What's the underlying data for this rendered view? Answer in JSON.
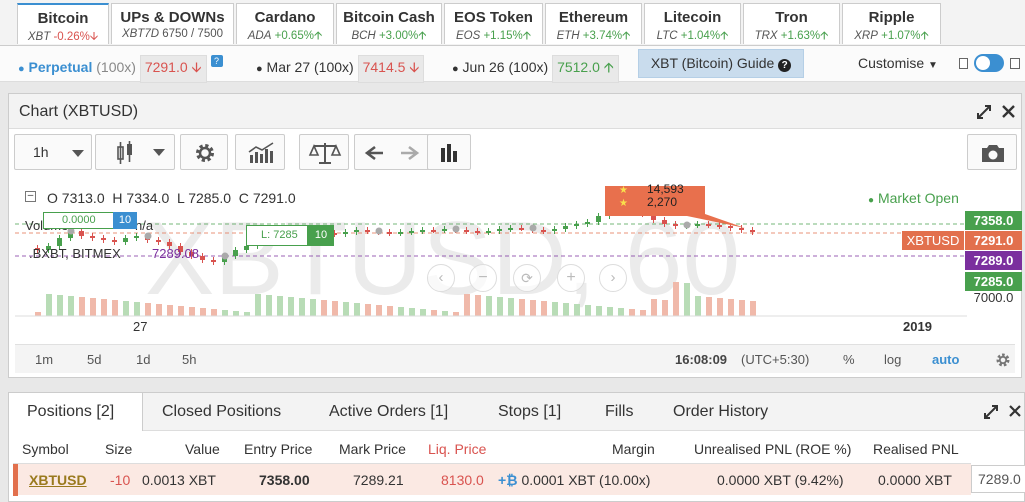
{
  "instruments": [
    {
      "name": "Bitcoin",
      "code": "XBT",
      "change": "-0.26%",
      "dir": "down"
    },
    {
      "name": "UPs & DOWNs",
      "code": "XBT7D",
      "change": "6750 / 7500",
      "dir": "none"
    },
    {
      "name": "Cardano",
      "code": "ADA",
      "change": "+0.65%",
      "dir": "up"
    },
    {
      "name": "Bitcoin Cash",
      "code": "BCH",
      "change": "+3.00%",
      "dir": "up"
    },
    {
      "name": "EOS Token",
      "code": "EOS",
      "change": "+1.15%",
      "dir": "up"
    },
    {
      "name": "Ethereum",
      "code": "ETH",
      "change": "+3.74%",
      "dir": "up"
    },
    {
      "name": "Litecoin",
      "code": "LTC",
      "change": "+1.04%",
      "dir": "up"
    },
    {
      "name": "Tron",
      "code": "TRX",
      "change": "+1.63%",
      "dir": "up"
    },
    {
      "name": "Ripple",
      "code": "XRP",
      "change": "+1.07%",
      "dir": "up"
    }
  ],
  "contracts": {
    "perpetual": {
      "label": "Perpetual",
      "lev": "(100x)",
      "price": "7291.0",
      "dir": "down"
    },
    "mar": {
      "label": "Mar 27",
      "lev": "(100x)",
      "price": "7414.5",
      "dir": "down"
    },
    "jun": {
      "label": "Jun 26",
      "lev": "(100x)",
      "price": "7512.0",
      "dir": "up"
    },
    "guide": "XBT (Bitcoin) Guide",
    "customise": "Customise"
  },
  "chart": {
    "title": "Chart (XBTUSD)",
    "interval": "1h",
    "watermark": "XBTUSD, 60",
    "ohlc": {
      "o_label": "O",
      "o": "7313.0",
      "h_label": "H",
      "h": "7334.0",
      "l_label": "L",
      "l": "7285.0",
      "c_label": "C",
      "c": "7291.0"
    },
    "volume_label": "Volume",
    "volume_value": "n/a",
    "index_label": ".BXBT, BITMEX",
    "index_value": "7289.08",
    "market_status": "Market Open",
    "order_tag": "0.0000",
    "order_qty": "10",
    "liq_tag": "L: 7285",
    "liq_qty": "10",
    "callout_1": "14,593",
    "callout_2": "2,270",
    "price_labels": [
      {
        "text": "7358.0",
        "color": "#48a04d"
      },
      {
        "text": "XBTUSD",
        "color": "#e2704d"
      },
      {
        "text": "7291.0",
        "color": "#e2704d"
      },
      {
        "text": "7289.0",
        "color": "#7b2f9e"
      },
      {
        "text": "7285.0",
        "color": "#48a04d"
      },
      {
        "text": "7000.0",
        "color": "#ffffff"
      }
    ],
    "x_tick_1": "27",
    "x_tick_2": "2019",
    "ranges": [
      "1m",
      "5d",
      "1d",
      "5h"
    ],
    "clock": "16:08:09",
    "tz": "(UTC+5:30)",
    "pct": "%",
    "log": "log",
    "auto": "auto"
  },
  "positions": {
    "tabs": [
      "Positions [2]",
      "Closed Positions",
      "Active Orders [1]",
      "Stops [1]",
      "Fills",
      "Order History"
    ],
    "headers": [
      "Symbol",
      "Size",
      "Value",
      "Entry Price",
      "Mark Price",
      "Liq. Price",
      "Margin",
      "Unrealised PNL (ROE %)",
      "Realised PNL"
    ],
    "row": {
      "symbol": "XBTUSD",
      "size": "-10",
      "value": "0.0013 XBT",
      "entry": "7358.00",
      "mark": "7289.21",
      "liq": "8130.0",
      "margin": "0.0001 XBT (10.00x)",
      "upnl": "0.0000 XBT (9.42%)",
      "rpnl": "0.0000 XBT",
      "close_price": "7289.0"
    }
  }
}
